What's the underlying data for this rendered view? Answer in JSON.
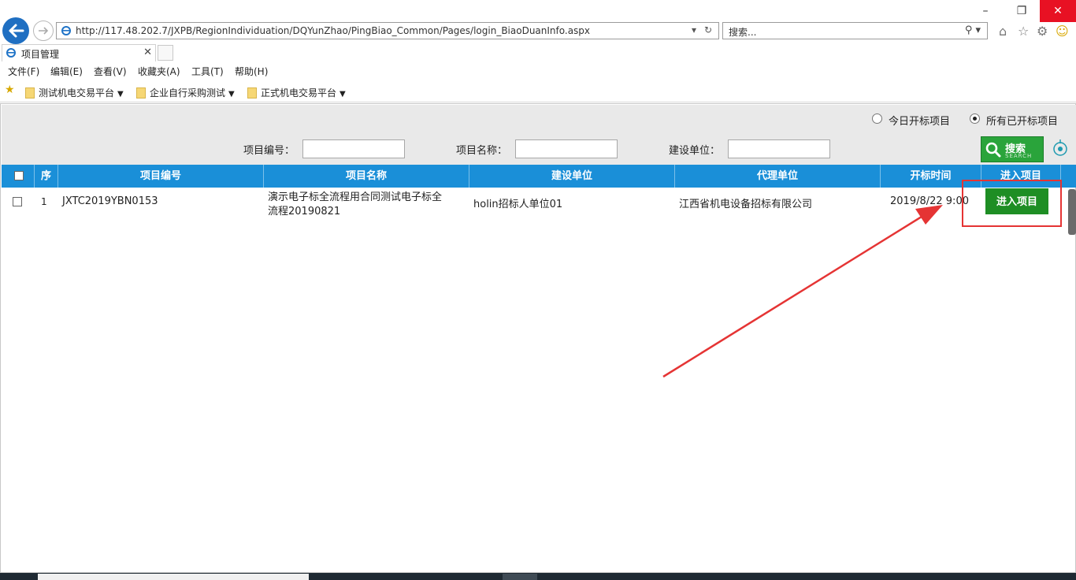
{
  "browser": {
    "url": "http://117.48.202.7/JXPB/RegionIndividuation/DQYunZhao/PingBiao_Common/Pages/login_BiaoDuanInfo.aspx",
    "search_placeholder": "搜索...",
    "tab_title": "项目管理"
  },
  "menu": [
    "文件(F)",
    "编辑(E)",
    "查看(V)",
    "收藏夹(A)",
    "工具(T)",
    "帮助(H)"
  ],
  "favorites": [
    "测试机电交易平台",
    "企业自行采购测试",
    "正式机电交易平台"
  ],
  "filters": {
    "radio_today": "今日开标项目",
    "radio_all": "所有已开标项目",
    "selected": "所有已开标项目",
    "project_no_label": "项目编号：",
    "project_name_label": "项目名称：",
    "builder_label": "建设单位：",
    "search_label": "搜索",
    "search_sub": "SEARCH"
  },
  "table": {
    "columns": [
      "序",
      "项目编号",
      "项目名称",
      "建设单位",
      "代理单位",
      "开标时间",
      "进入项目"
    ],
    "rows": [
      {
        "index": "1",
        "project_no": "JXTC2019YBN0153",
        "project_name_line1": "演示电子标全流程用合同测试电子标全",
        "project_name_line2": "流程20190821",
        "builder": "holin招标人单位01",
        "agent": "江西省机电设备招标有限公司",
        "open_time": "2019/8/22 9:00",
        "action": "进入项目"
      }
    ]
  },
  "colors": {
    "header_blue": "#1a8fd8",
    "button_green": "#1e8e24",
    "annotation_red": "#e53434"
  }
}
